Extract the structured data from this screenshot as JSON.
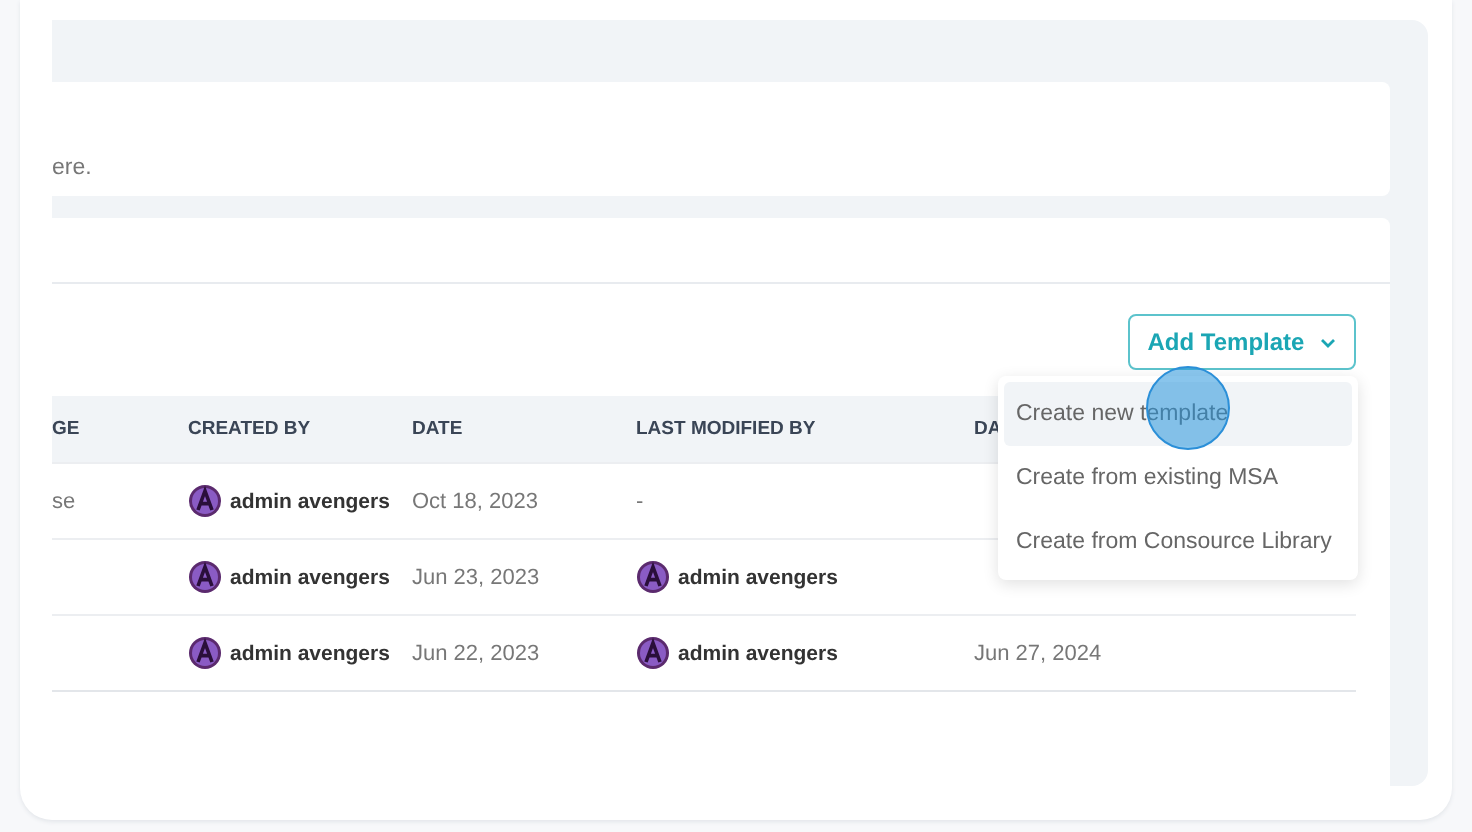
{
  "description_fragment": "ere.",
  "add_button": {
    "label": "Add Template",
    "expanded": true
  },
  "menu": {
    "items": [
      {
        "label": "Create new template",
        "selected": true
      },
      {
        "label": "Create from existing MSA",
        "selected": false
      },
      {
        "label": "Create from Consource Library",
        "selected": false
      }
    ]
  },
  "table": {
    "columns": [
      "GE",
      "CREATED BY",
      "DATE",
      "LAST MODIFIED BY",
      "DA"
    ],
    "rows": [
      {
        "column_1": "se",
        "created_by": "admin avengers",
        "date": "Oct 18, 2023",
        "last_modified_by": "-",
        "last_modified_by_avatar": false
      },
      {
        "created_by": "admin avengers",
        "date": "Jun 23, 2023",
        "last_modified_by": "admin avengers",
        "last_modified_by_avatar": true
      },
      {
        "created_by": "admin avengers",
        "date": "Jun 22, 2023",
        "last_modified_by": "admin avengers",
        "last_modified_by_avatar": true,
        "column_5": "Jun 27, 2024"
      }
    ]
  }
}
